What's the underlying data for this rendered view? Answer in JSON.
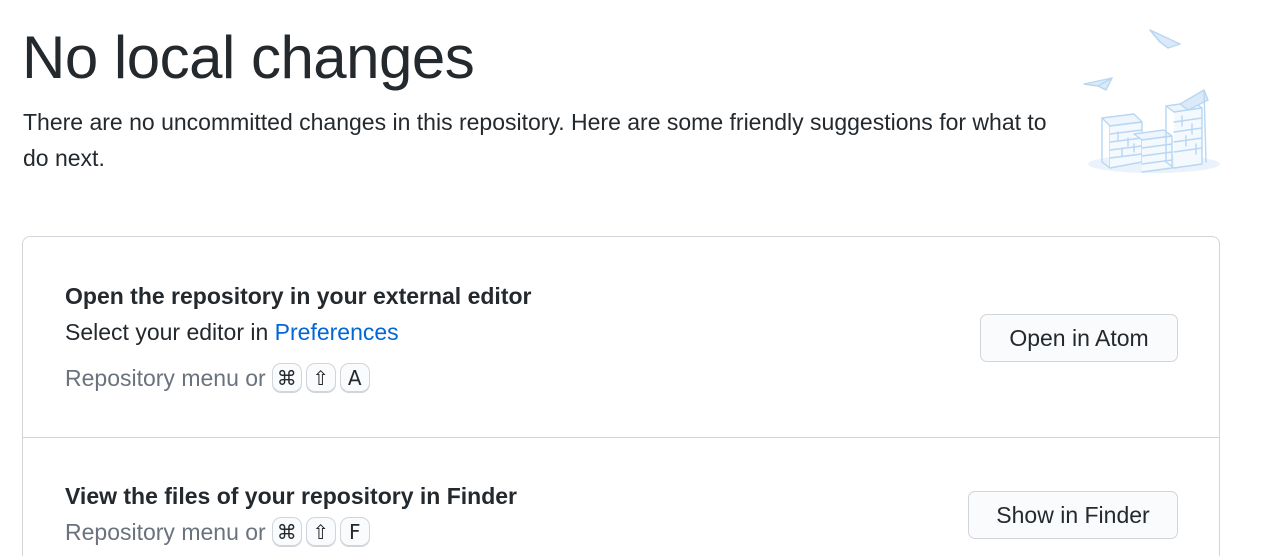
{
  "header": {
    "title": "No local changes",
    "description": "There are no uncommitted changes in this repository. Here are some friendly suggestions for what to do next."
  },
  "illustration": {
    "icon": "empty-files-illustration-icon"
  },
  "suggestions": [
    {
      "title": "Open the repository in your external editor",
      "description_prefix": "Select your editor in ",
      "link_label": "Preferences",
      "shortcut_label": "Repository menu or",
      "keys": [
        "⌘",
        "⇧",
        "A"
      ],
      "button_label": "Open in Atom"
    },
    {
      "title": "View the files of your repository in Finder",
      "shortcut_label": "Repository menu or",
      "keys": [
        "⌘",
        "⇧",
        "F"
      ],
      "button_label": "Show in Finder"
    }
  ],
  "colors": {
    "text": "#24292e",
    "muted": "#6a737d",
    "link": "#0366d6",
    "border": "#d1d5da",
    "illustration": "#c8e1f7"
  }
}
